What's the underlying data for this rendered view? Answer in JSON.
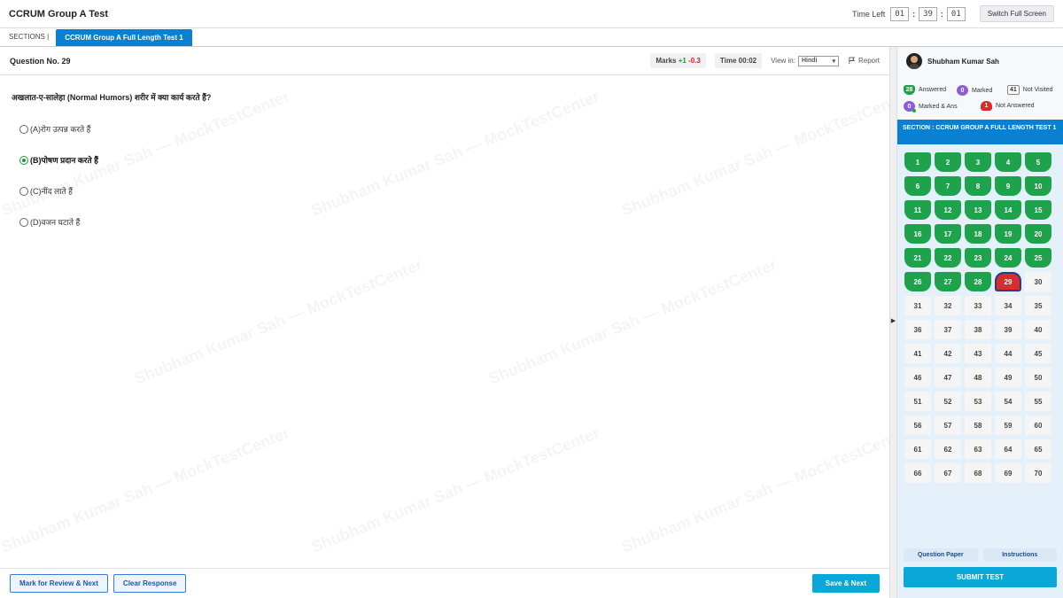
{
  "header": {
    "title": "CCRUM Group A Test",
    "time_left_label": "Time Left",
    "time_h": "01",
    "time_m": "39",
    "time_s": "01",
    "fullscreen_label": "Switch Full Screen"
  },
  "sections": {
    "label": "SECTIONS |",
    "active_tab": "CCRUM Group A Full Length Test 1"
  },
  "question": {
    "number_label": "Question No. 29",
    "marks_label": "Marks",
    "marks_pos": "+1",
    "marks_neg": "-0.3",
    "time_label": "Time 00:02",
    "view_in_label": "View in:",
    "language": "Hindi",
    "report_label": "Report",
    "text": "अखलात-ए-सालेहा (Normal Humors) शरीर में क्या कार्य करते हैं?",
    "options": [
      {
        "label": "(A)रोग उत्पन्न करते हैं",
        "selected": false
      },
      {
        "label": "(B)पोषण प्रदान करते हैं",
        "selected": true
      },
      {
        "label": "(C)नींद लाते हैं",
        "selected": false
      },
      {
        "label": "(D)वजन घटाते हैं",
        "selected": false
      }
    ]
  },
  "watermark": "Shubham Kumar Sah — MockTestCenter",
  "footer": {
    "mark_review": "Mark for Review & Next",
    "clear": "Clear Response",
    "save_next": "Save & Next"
  },
  "panel": {
    "user_name": "Shubham Kumar Sah",
    "legend": {
      "answered_count": "28",
      "answered_label": "Answered",
      "marked_count": "0",
      "marked_label": "Marked",
      "not_visited_count": "41",
      "not_visited_label": "Not Visited",
      "marked_ans_count": "0",
      "marked_ans_label": "Marked & Ans",
      "not_answered_count": "1",
      "not_answered_label": "Not Answered"
    },
    "section_title": "SECTION : CCRUM GROUP A FULL LENGTH TEST 1",
    "total_questions": 70,
    "answered_through": 28,
    "not_answered": [
      29
    ],
    "question_paper": "Question Paper",
    "instructions": "Instructions",
    "submit": "SUBMIT TEST"
  },
  "colors": {
    "primary": "#0a80d2",
    "answered": "#1ea24b",
    "not_answered": "#d62d2d",
    "marked": "#8a5fd6",
    "save": "#0aa8d8"
  }
}
